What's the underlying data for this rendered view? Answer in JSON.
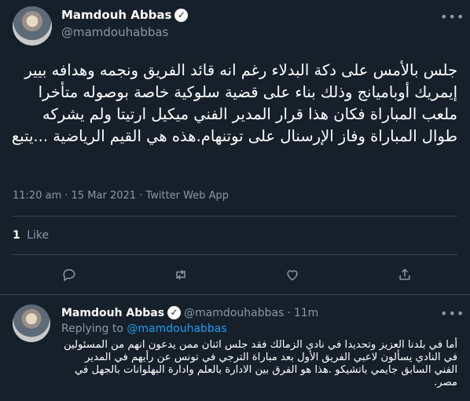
{
  "tweet": {
    "author_name": "Mamdouh Abbas",
    "author_handle": "@mamdouhabbas",
    "text": "جلس بالأمس على دكة البدلاء رغم انه قائد الفريق ونجمه وهدافه بيير إيمريك أوباميانج وذلك بناء على قضية سلوكية خاصة بوصوله متأخرا ملعب المباراة فكان هذا قرار المدير الفني ميكيل ارتيتا ولم يشركه طوال المباراة وفاز الإرسنال على توتنهام.هذه هي القيم الرياضية ...يتبع",
    "timestamp": "11:20 am · 15 Mar 2021 · Twitter Web App",
    "likes_count": "1",
    "likes_label": "Like"
  },
  "reply": {
    "author_name": "Mamdouh Abbas",
    "author_handle": "@mamdouhabbas",
    "separator": "·",
    "time_ago": "11m",
    "replying_to_label": "Replying to",
    "replying_to_handle": "@mamdouhabbas",
    "text": "أما في بلدنا العزيز وتحديدا في نادي الزمالك فقد جلس اثنان ممن يدعون انهم من المسئولين في النادي يسألون لاعبي الفريق الأول بعد مباراة الترجي في تونس عن رأيهم في المدير الفني السابق جايمي باتشيكو .هذا هو الفرق بين الادارة بالعلم وادارة البهلوانات بالجهل في مصر."
  },
  "icons": {
    "more": "more-icon",
    "verified": "verified-badge-icon",
    "reply": "reply-icon",
    "retweet": "retweet-icon",
    "like": "like-icon",
    "share": "share-icon"
  },
  "colors": {
    "background": "#15202b",
    "accent": "#1d9bf0",
    "muted": "#8b98a5",
    "divider": "#38444d"
  }
}
